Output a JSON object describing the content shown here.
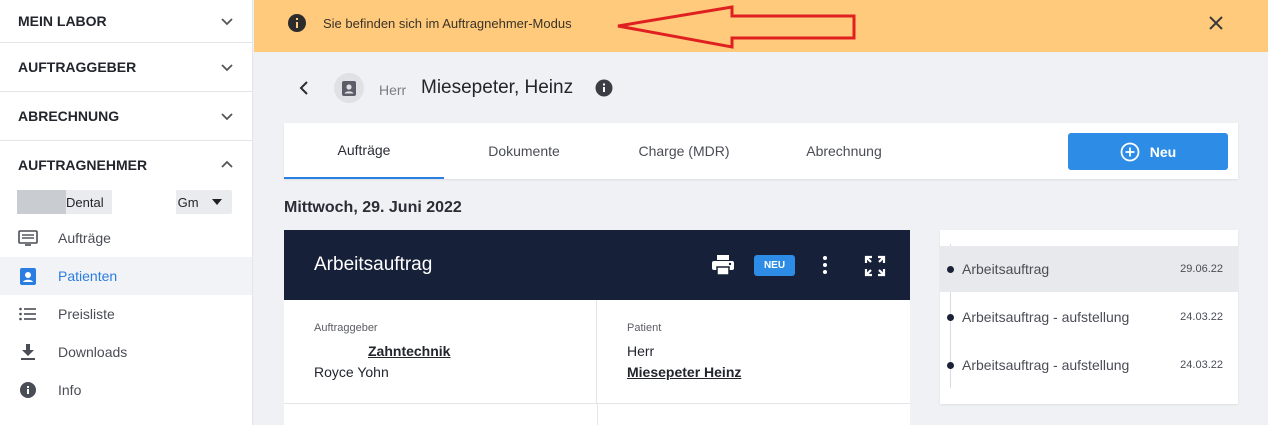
{
  "sidebar": {
    "sections": [
      {
        "label": "MEIN LABOR"
      },
      {
        "label": "AUFTRAGGEBER"
      },
      {
        "label": "ABRECHNUNG"
      },
      {
        "label": "AUFTRAGNEHMER"
      }
    ],
    "lab_select": {
      "part1": "Dental",
      "part2": "Gm"
    },
    "nav": [
      {
        "label": "Aufträge",
        "icon": "orders-icon"
      },
      {
        "label": "Patienten",
        "icon": "patient-icon",
        "active": true
      },
      {
        "label": "Preisliste",
        "icon": "list-icon"
      },
      {
        "label": "Downloads",
        "icon": "download-icon"
      },
      {
        "label": "Info",
        "icon": "info-icon"
      }
    ]
  },
  "banner": {
    "message": "Sie befinden sich im Auftragnehmer-Modus"
  },
  "patient": {
    "salutation": "Herr",
    "name": "Miesepeter, Heinz"
  },
  "tabs": [
    {
      "label": "Aufträge",
      "active": true
    },
    {
      "label": "Dokumente"
    },
    {
      "label": "Charge (MDR)"
    },
    {
      "label": "Abrechnung"
    }
  ],
  "new_button": {
    "label": "Neu"
  },
  "date_heading": "Mittwoch, 29. Juni 2022",
  "order": {
    "title": "Arbeitsauftrag",
    "badge": "NEU",
    "client_label": "Auftraggeber",
    "client_name": "Zahntechnik",
    "client_contact": "Royce Yohn",
    "patient_label": "Patient",
    "patient_salutation": "Herr",
    "patient_name": "Miesepeter Heinz"
  },
  "timeline": [
    {
      "label": "Arbeitsauftrag",
      "date": "29.06.22",
      "selected": true
    },
    {
      "label": "Arbeitsauftrag - aufstellung",
      "date": "24.03.22"
    },
    {
      "label": "Arbeitsauftrag - aufstellung",
      "date": "24.03.22"
    }
  ],
  "colors": {
    "accent": "#2d8ce6",
    "banner": "#ffca7c",
    "header_dark": "#172039",
    "annotation_arrow": "#e02020"
  }
}
